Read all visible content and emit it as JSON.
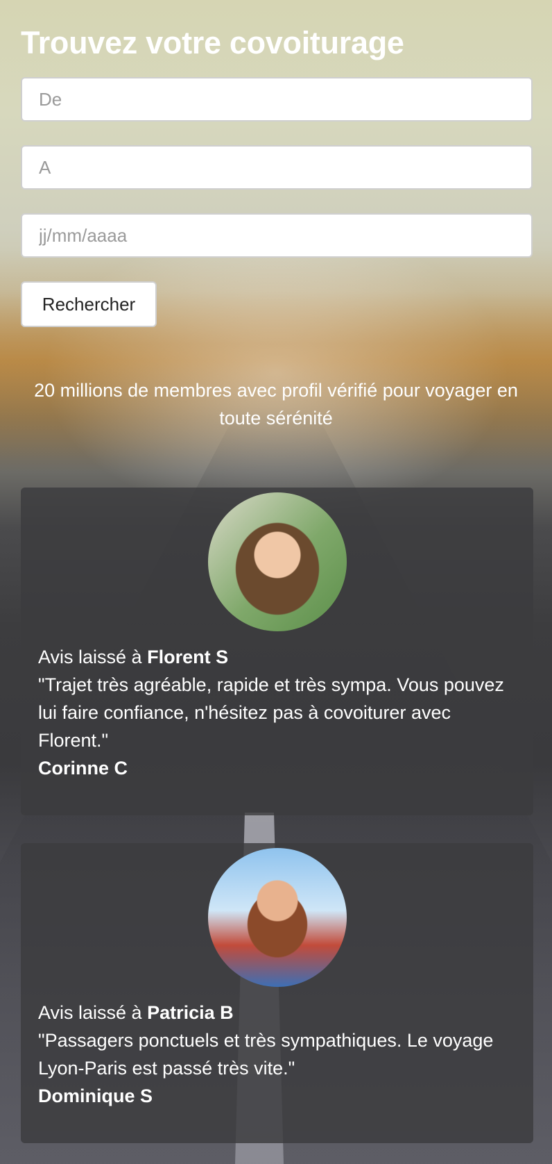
{
  "header": {
    "title": "Trouvez votre covoiturage"
  },
  "search": {
    "from_placeholder": "De",
    "to_placeholder": "A",
    "date_placeholder": "jj/mm/aaaa",
    "button_label": "Rechercher"
  },
  "tagline": "20 millions de membres avec profil vérifié pour voyager en toute sérénité",
  "reviews": [
    {
      "prefix": "Avis laissé à ",
      "recipient": "Florent S",
      "quote": "\"Trajet très agréable, rapide et très sympa. Vous pouvez lui faire confiance, n'hésitez pas à covoiturer avec Florent.\"",
      "author": "Corinne C"
    },
    {
      "prefix": "Avis laissé à ",
      "recipient": "Patricia B",
      "quote": "\"Passagers ponctuels et très sympathiques. Le voyage Lyon-Paris est passé très vite.\"",
      "author": "Dominique S"
    }
  ]
}
